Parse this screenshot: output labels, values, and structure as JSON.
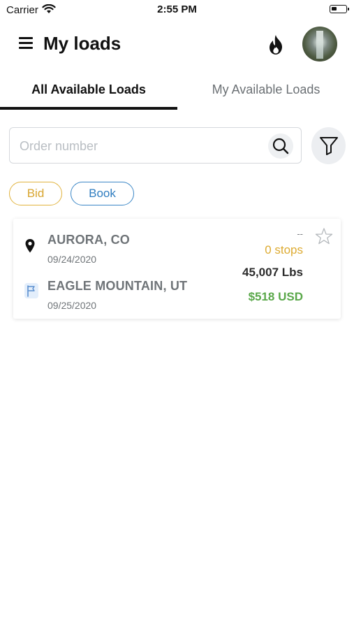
{
  "status_bar": {
    "carrier": "Carrier",
    "time": "2:55 PM"
  },
  "header": {
    "title": "My loads"
  },
  "tabs": [
    {
      "label": "All Available Loads",
      "active": true
    },
    {
      "label": "My Available Loads",
      "active": false
    }
  ],
  "search": {
    "placeholder": "Order number",
    "value": ""
  },
  "chips": [
    {
      "label": "Bid",
      "color": "#d8a52f"
    },
    {
      "label": "Book",
      "color": "#2f7dc0"
    }
  ],
  "load": {
    "origin_city": "AURORA, CO",
    "origin_date": "09/24/2020",
    "destination_city": "EAGLE MOUNTAIN, UT",
    "destination_date": "09/25/2020",
    "dash": "--",
    "stops": "0 stops",
    "weight": "45,007 Lbs",
    "price": "$518 USD"
  },
  "icons": [
    "menu-icon",
    "fire-icon",
    "search-icon",
    "filter-icon",
    "location-pin-icon",
    "flag-icon",
    "star-icon"
  ],
  "colors": {
    "accent_bid": "#d8a52f",
    "accent_book": "#2f7dc0",
    "price_green": "#5aa84a"
  }
}
